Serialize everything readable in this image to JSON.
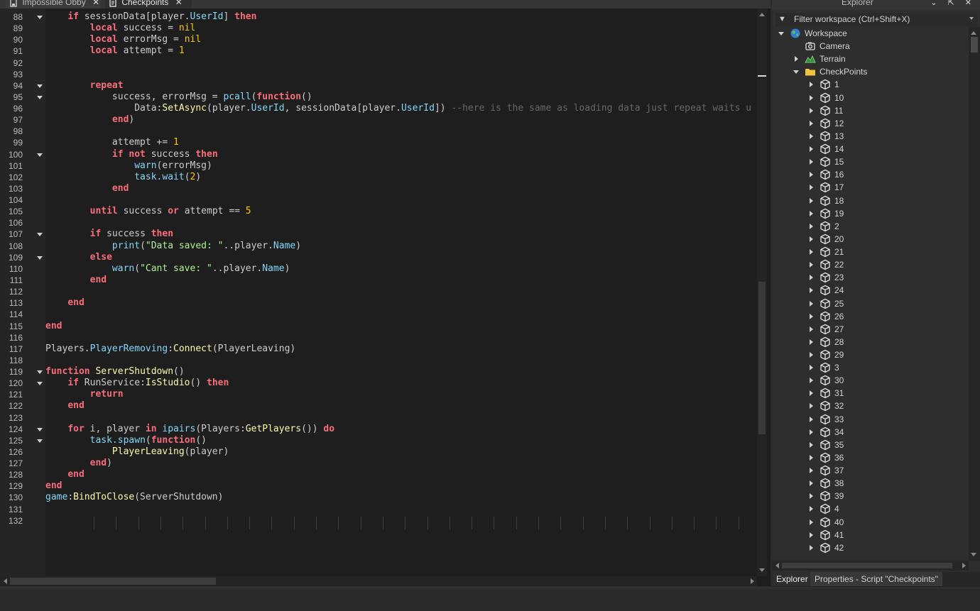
{
  "tabs": [
    {
      "label": "Impossible Obby",
      "active": false
    },
    {
      "label": "Checkpoints",
      "active": true
    }
  ],
  "close_glyph": "✕",
  "code": {
    "lines": [
      {
        "n": "88",
        "fold": true,
        "tokens": [
          [
            "",
            "    "
          ],
          [
            "k",
            "if"
          ],
          [
            "",
            " sessionData[player."
          ],
          [
            "p",
            "UserId"
          ],
          [
            "",
            "] "
          ],
          [
            "k",
            "then"
          ]
        ]
      },
      {
        "n": "89",
        "fold": false,
        "tokens": [
          [
            "",
            "        "
          ],
          [
            "k",
            "local"
          ],
          [
            "",
            " success = "
          ],
          [
            "n",
            "nil"
          ]
        ]
      },
      {
        "n": "90",
        "fold": false,
        "tokens": [
          [
            "",
            "        "
          ],
          [
            "k",
            "local"
          ],
          [
            "",
            " errorMsg = "
          ],
          [
            "n",
            "nil"
          ]
        ]
      },
      {
        "n": "91",
        "fold": false,
        "tokens": [
          [
            "",
            "        "
          ],
          [
            "k",
            "local"
          ],
          [
            "",
            " attempt = "
          ],
          [
            "n",
            "1"
          ]
        ]
      },
      {
        "n": "92",
        "fold": false,
        "tokens": []
      },
      {
        "n": "93",
        "fold": false,
        "tokens": []
      },
      {
        "n": "94",
        "fold": true,
        "tokens": [
          [
            "",
            "        "
          ],
          [
            "k",
            "repeat"
          ]
        ]
      },
      {
        "n": "95",
        "fold": true,
        "tokens": [
          [
            "",
            "            success, errorMsg = "
          ],
          [
            "p",
            "pcall"
          ],
          [
            "",
            "("
          ],
          [
            "k",
            "function"
          ],
          [
            "",
            "()"
          ]
        ]
      },
      {
        "n": "96",
        "fold": false,
        "tokens": [
          [
            "",
            "                Data:"
          ],
          [
            "f",
            "SetAsync"
          ],
          [
            "",
            "(player."
          ],
          [
            "p",
            "UserId"
          ],
          [
            "",
            ", sessionData[player."
          ],
          [
            "p",
            "UserId"
          ],
          [
            "",
            "]) "
          ],
          [
            "c",
            "--here is the same as loading data just repeat waits u"
          ]
        ]
      },
      {
        "n": "97",
        "fold": false,
        "tokens": [
          [
            "",
            "            "
          ],
          [
            "k",
            "end"
          ],
          [
            "",
            ")"
          ]
        ]
      },
      {
        "n": "98",
        "fold": false,
        "tokens": []
      },
      {
        "n": "99",
        "fold": false,
        "tokens": [
          [
            "",
            "            attempt += "
          ],
          [
            "n",
            "1"
          ]
        ]
      },
      {
        "n": "100",
        "fold": true,
        "tokens": [
          [
            "",
            "            "
          ],
          [
            "k",
            "if not"
          ],
          [
            "",
            " success "
          ],
          [
            "k",
            "then"
          ]
        ]
      },
      {
        "n": "101",
        "fold": false,
        "tokens": [
          [
            "",
            "                "
          ],
          [
            "p",
            "warn"
          ],
          [
            "",
            "(errorMsg)"
          ]
        ]
      },
      {
        "n": "102",
        "fold": false,
        "tokens": [
          [
            "",
            "                "
          ],
          [
            "p",
            "task.wait"
          ],
          [
            "",
            "("
          ],
          [
            "n",
            "2"
          ],
          [
            "",
            ")"
          ]
        ]
      },
      {
        "n": "103",
        "fold": false,
        "tokens": [
          [
            "",
            "            "
          ],
          [
            "k",
            "end"
          ]
        ]
      },
      {
        "n": "104",
        "fold": false,
        "tokens": []
      },
      {
        "n": "105",
        "fold": false,
        "tokens": [
          [
            "",
            "        "
          ],
          [
            "k",
            "until"
          ],
          [
            "",
            " success "
          ],
          [
            "k",
            "or"
          ],
          [
            "",
            " attempt == "
          ],
          [
            "n",
            "5"
          ]
        ]
      },
      {
        "n": "106",
        "fold": false,
        "tokens": []
      },
      {
        "n": "107",
        "fold": true,
        "tokens": [
          [
            "",
            "        "
          ],
          [
            "k",
            "if"
          ],
          [
            "",
            " success "
          ],
          [
            "k",
            "then"
          ]
        ]
      },
      {
        "n": "108",
        "fold": false,
        "tokens": [
          [
            "",
            "            "
          ],
          [
            "p",
            "print"
          ],
          [
            "",
            "("
          ],
          [
            "s",
            "\"Data saved: \""
          ],
          [
            "",
            "..player."
          ],
          [
            "p",
            "Name"
          ],
          [
            "",
            ")"
          ]
        ]
      },
      {
        "n": "109",
        "fold": true,
        "tokens": [
          [
            "",
            "        "
          ],
          [
            "k",
            "else"
          ]
        ]
      },
      {
        "n": "110",
        "fold": false,
        "tokens": [
          [
            "",
            "            "
          ],
          [
            "p",
            "warn"
          ],
          [
            "",
            "("
          ],
          [
            "s",
            "\"Cant save: \""
          ],
          [
            "",
            "..player."
          ],
          [
            "p",
            "Name"
          ],
          [
            "",
            ")"
          ]
        ]
      },
      {
        "n": "111",
        "fold": false,
        "tokens": [
          [
            "",
            "        "
          ],
          [
            "k",
            "end"
          ]
        ]
      },
      {
        "n": "112",
        "fold": false,
        "tokens": []
      },
      {
        "n": "113",
        "fold": false,
        "tokens": [
          [
            "",
            "    "
          ],
          [
            "k",
            "end"
          ]
        ]
      },
      {
        "n": "114",
        "fold": false,
        "tokens": []
      },
      {
        "n": "115",
        "fold": false,
        "tokens": [
          [
            "k",
            "end"
          ]
        ]
      },
      {
        "n": "116",
        "fold": false,
        "tokens": []
      },
      {
        "n": "117",
        "fold": false,
        "tokens": [
          [
            "",
            "Players."
          ],
          [
            "p",
            "PlayerRemoving"
          ],
          [
            "",
            ":"
          ],
          [
            "f",
            "Connect"
          ],
          [
            "",
            "(PlayerLeaving)"
          ]
        ]
      },
      {
        "n": "118",
        "fold": false,
        "tokens": []
      },
      {
        "n": "119",
        "fold": true,
        "tokens": [
          [
            "k",
            "function"
          ],
          [
            "",
            " "
          ],
          [
            "f",
            "ServerShutdown"
          ],
          [
            "",
            "()"
          ]
        ]
      },
      {
        "n": "120",
        "fold": true,
        "tokens": [
          [
            "",
            "    "
          ],
          [
            "k",
            "if"
          ],
          [
            "",
            " RunService:"
          ],
          [
            "f",
            "IsStudio"
          ],
          [
            "",
            "() "
          ],
          [
            "k",
            "then"
          ]
        ]
      },
      {
        "n": "121",
        "fold": false,
        "tokens": [
          [
            "",
            "        "
          ],
          [
            "k",
            "return"
          ]
        ]
      },
      {
        "n": "122",
        "fold": false,
        "tokens": [
          [
            "",
            "    "
          ],
          [
            "k",
            "end"
          ]
        ]
      },
      {
        "n": "123",
        "fold": false,
        "tokens": []
      },
      {
        "n": "124",
        "fold": true,
        "tokens": [
          [
            "",
            "    "
          ],
          [
            "k",
            "for"
          ],
          [
            "",
            " i, player "
          ],
          [
            "k",
            "in"
          ],
          [
            "",
            " "
          ],
          [
            "p",
            "ipairs"
          ],
          [
            "",
            "(Players:"
          ],
          [
            "f",
            "GetPlayers"
          ],
          [
            "",
            "()) "
          ],
          [
            "k",
            "do"
          ]
        ]
      },
      {
        "n": "125",
        "fold": true,
        "tokens": [
          [
            "",
            "        "
          ],
          [
            "p",
            "task.spawn"
          ],
          [
            "",
            "("
          ],
          [
            "k",
            "function"
          ],
          [
            "",
            "()"
          ]
        ]
      },
      {
        "n": "126",
        "fold": false,
        "tokens": [
          [
            "",
            "            "
          ],
          [
            "f",
            "PlayerLeaving"
          ],
          [
            "",
            "(player)"
          ]
        ]
      },
      {
        "n": "127",
        "fold": false,
        "tokens": [
          [
            "",
            "        "
          ],
          [
            "k",
            "end"
          ],
          [
            "",
            ")"
          ]
        ]
      },
      {
        "n": "128",
        "fold": false,
        "tokens": [
          [
            "",
            "    "
          ],
          [
            "k",
            "end"
          ]
        ]
      },
      {
        "n": "129",
        "fold": false,
        "tokens": [
          [
            "k",
            "end"
          ]
        ]
      },
      {
        "n": "130",
        "fold": false,
        "tokens": [
          [
            "p",
            "game"
          ],
          [
            "",
            ":"
          ],
          [
            "f",
            "BindToClose"
          ],
          [
            "",
            "(ServerShutdown)"
          ]
        ]
      },
      {
        "n": "131",
        "fold": false,
        "tokens": []
      },
      {
        "n": "132",
        "fold": false,
        "tokens": []
      }
    ]
  },
  "explorer": {
    "title": "Explorer",
    "title_buttons": "⌄ ⇱ ✕",
    "filter_icon": "▼",
    "filter_placeholder": "Filter workspace (Ctrl+Shift+X)",
    "tree": [
      {
        "label": "Workspace",
        "icon": "workspace-globe-icon",
        "depth": 0,
        "arrow": "down"
      },
      {
        "label": "Camera",
        "icon": "camera-icon",
        "depth": 1,
        "arrow": "none"
      },
      {
        "label": "Terrain",
        "icon": "terrain-icon",
        "depth": 1,
        "arrow": "right"
      },
      {
        "label": "CheckPoints",
        "icon": "folder-icon",
        "depth": 1,
        "arrow": "down"
      },
      {
        "label": "1",
        "icon": "part-cube-icon",
        "depth": 2,
        "arrow": "right"
      },
      {
        "label": "10",
        "icon": "part-cube-icon",
        "depth": 2,
        "arrow": "right"
      },
      {
        "label": "11",
        "icon": "part-cube-icon",
        "depth": 2,
        "arrow": "right"
      },
      {
        "label": "12",
        "icon": "part-cube-icon",
        "depth": 2,
        "arrow": "right"
      },
      {
        "label": "13",
        "icon": "part-cube-icon",
        "depth": 2,
        "arrow": "right"
      },
      {
        "label": "14",
        "icon": "part-cube-icon",
        "depth": 2,
        "arrow": "right"
      },
      {
        "label": "15",
        "icon": "part-cube-icon",
        "depth": 2,
        "arrow": "right"
      },
      {
        "label": "16",
        "icon": "part-cube-icon",
        "depth": 2,
        "arrow": "right"
      },
      {
        "label": "17",
        "icon": "part-cube-icon",
        "depth": 2,
        "arrow": "right"
      },
      {
        "label": "18",
        "icon": "part-cube-icon",
        "depth": 2,
        "arrow": "right"
      },
      {
        "label": "19",
        "icon": "part-cube-icon",
        "depth": 2,
        "arrow": "right"
      },
      {
        "label": "2",
        "icon": "part-cube-icon",
        "depth": 2,
        "arrow": "right"
      },
      {
        "label": "20",
        "icon": "part-cube-icon",
        "depth": 2,
        "arrow": "right"
      },
      {
        "label": "21",
        "icon": "part-cube-icon",
        "depth": 2,
        "arrow": "right"
      },
      {
        "label": "22",
        "icon": "part-cube-icon",
        "depth": 2,
        "arrow": "right"
      },
      {
        "label": "23",
        "icon": "part-cube-icon",
        "depth": 2,
        "arrow": "right"
      },
      {
        "label": "24",
        "icon": "part-cube-icon",
        "depth": 2,
        "arrow": "right"
      },
      {
        "label": "25",
        "icon": "part-cube-icon",
        "depth": 2,
        "arrow": "right"
      },
      {
        "label": "26",
        "icon": "part-cube-icon",
        "depth": 2,
        "arrow": "right"
      },
      {
        "label": "27",
        "icon": "part-cube-icon",
        "depth": 2,
        "arrow": "right"
      },
      {
        "label": "28",
        "icon": "part-cube-icon",
        "depth": 2,
        "arrow": "right"
      },
      {
        "label": "29",
        "icon": "part-cube-icon",
        "depth": 2,
        "arrow": "right"
      },
      {
        "label": "3",
        "icon": "part-cube-icon",
        "depth": 2,
        "arrow": "right"
      },
      {
        "label": "30",
        "icon": "part-cube-icon",
        "depth": 2,
        "arrow": "right"
      },
      {
        "label": "31",
        "icon": "part-cube-icon",
        "depth": 2,
        "arrow": "right"
      },
      {
        "label": "32",
        "icon": "part-cube-icon",
        "depth": 2,
        "arrow": "right"
      },
      {
        "label": "33",
        "icon": "part-cube-icon",
        "depth": 2,
        "arrow": "right"
      },
      {
        "label": "34",
        "icon": "part-cube-icon",
        "depth": 2,
        "arrow": "right"
      },
      {
        "label": "35",
        "icon": "part-cube-icon",
        "depth": 2,
        "arrow": "right"
      },
      {
        "label": "36",
        "icon": "part-cube-icon",
        "depth": 2,
        "arrow": "right"
      },
      {
        "label": "37",
        "icon": "part-cube-icon",
        "depth": 2,
        "arrow": "right"
      },
      {
        "label": "38",
        "icon": "part-cube-icon",
        "depth": 2,
        "arrow": "right"
      },
      {
        "label": "39",
        "icon": "part-cube-icon",
        "depth": 2,
        "arrow": "right"
      },
      {
        "label": "4",
        "icon": "part-cube-icon",
        "depth": 2,
        "arrow": "right"
      },
      {
        "label": "40",
        "icon": "part-cube-icon",
        "depth": 2,
        "arrow": "right"
      },
      {
        "label": "41",
        "icon": "part-cube-icon",
        "depth": 2,
        "arrow": "right"
      },
      {
        "label": "42",
        "icon": "part-cube-icon",
        "depth": 2,
        "arrow": "right"
      }
    ]
  },
  "bottom_tabs": [
    {
      "label": "Explorer",
      "active": true
    },
    {
      "label": "Properties - Script \"Checkpoints\"",
      "active": false
    }
  ],
  "colors": {
    "keyword": "#f86d7c",
    "builtin": "#84d6f7",
    "method": "#fdfbac",
    "number": "#ffc600",
    "string": "#adf195",
    "comment": "#666666",
    "text": "#cccccc",
    "editor_bg": "#1e1e1e"
  }
}
